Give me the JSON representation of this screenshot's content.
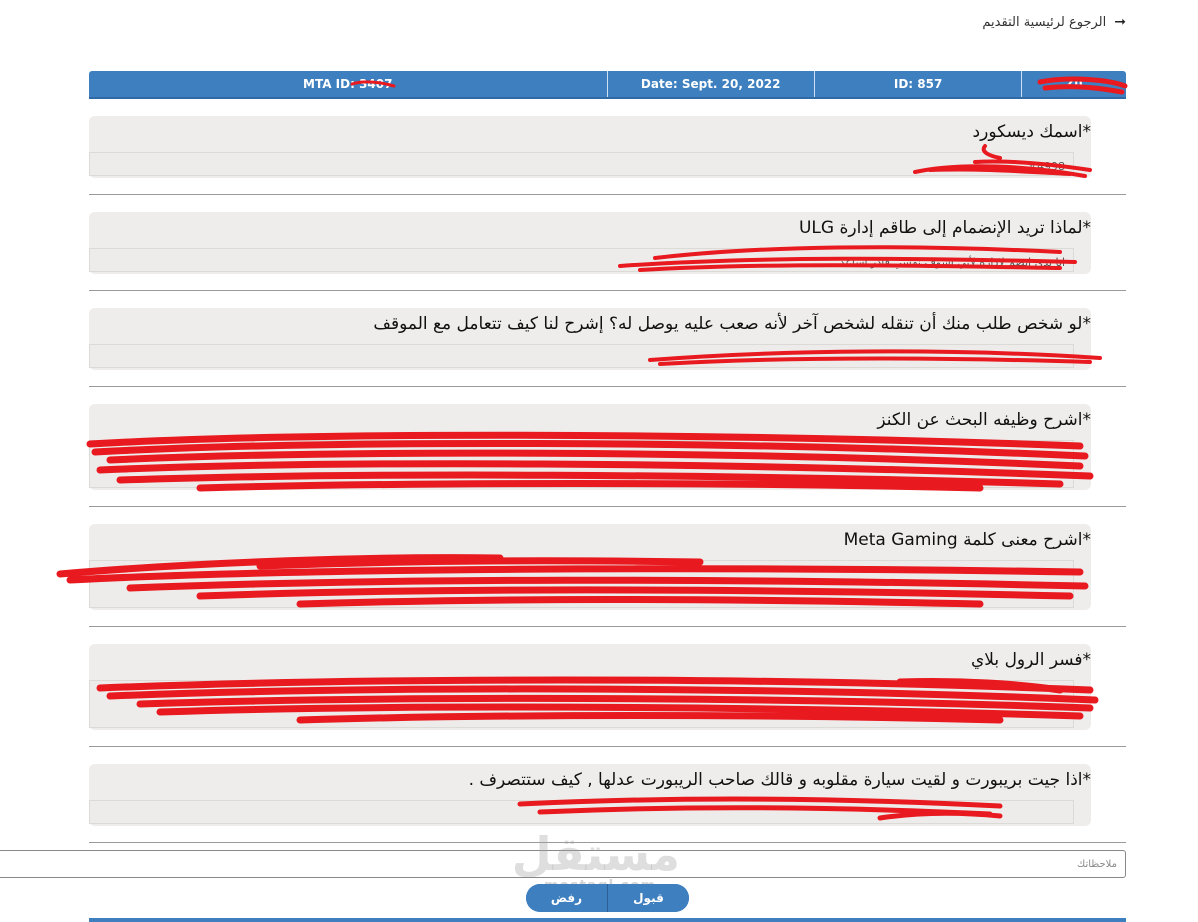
{
  "nav": {
    "back_label": "الرجوع لرئيسية التقديم"
  },
  "header": {
    "mta_id": "MTA ID: 3407",
    "date": "Date: Sept. 20, 2022",
    "id": "ID: 857",
    "name": "Zu"
  },
  "questions": [
    {
      "title": "*اسمك ديسكورد",
      "answer": "#4998"
    },
    {
      "title": "*لماذا تريد الإنضمام إلى طاقم إدارة ULG",
      "answer": "انا بدي انضم لإدارة لأني اشوف نفسي قادر اساعد"
    },
    {
      "title": "*لو شخص طلب منك أن تنقله لشخص آخر لأنه صعب عليه يوصل له؟ إشرح لنا كيف تتعامل مع الموقف",
      "answer": ""
    },
    {
      "title": "*اشرح وظيفه البحث عن الكنز",
      "answer": ""
    },
    {
      "title": "*اشرح معنى كلمة Meta Gaming",
      "answer": ""
    },
    {
      "title": "*فسر الرول بلاي",
      "answer": ""
    },
    {
      "title": "*اذا جيت بريبورت و لقيت سيارة مقلوبه و قالك صاحب الريبورت عدلها , كيف ستتصرف .",
      "answer": ""
    }
  ],
  "notes": {
    "placeholder": "ملاحظاتك"
  },
  "actions": {
    "accept_label": "قبول",
    "reject_label": "رفض"
  },
  "watermark": {
    "main": "مستقل",
    "sub": "mostaql.com"
  },
  "colors": {
    "header": "#3d7fbf",
    "card": "#efedeb",
    "redaction": "#e8191f"
  }
}
